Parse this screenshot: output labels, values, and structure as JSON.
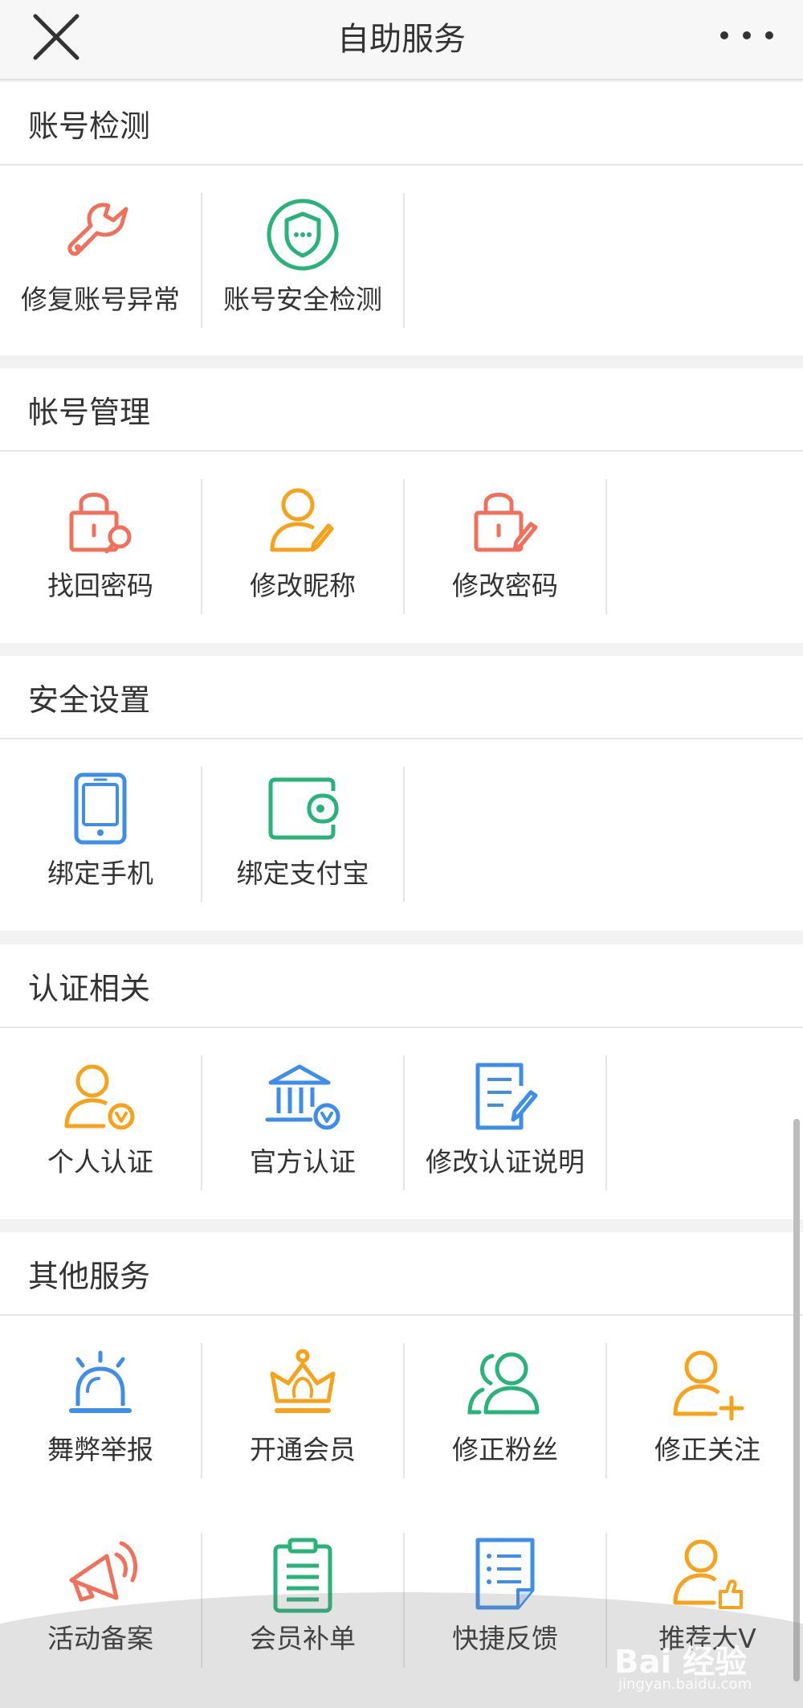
{
  "header": {
    "title": "自助服务"
  },
  "sections": [
    {
      "title": "账号检测",
      "items": [
        {
          "label": "修复账号异常",
          "icon": "wrench-icon",
          "color": "#f0705c"
        },
        {
          "label": "账号安全检测",
          "icon": "shield-icon",
          "color": "#27b37a"
        }
      ]
    },
    {
      "title": "帐号管理",
      "items": [
        {
          "label": "找回密码",
          "icon": "lock-search-icon",
          "color": "#f0705c"
        },
        {
          "label": "修改昵称",
          "icon": "user-edit-icon",
          "color": "#f7a21b"
        },
        {
          "label": "修改密码",
          "icon": "lock-edit-icon",
          "color": "#f0705c"
        }
      ]
    },
    {
      "title": "安全设置",
      "items": [
        {
          "label": "绑定手机",
          "icon": "phone-icon",
          "color": "#3e8ee9"
        },
        {
          "label": "绑定支付宝",
          "icon": "wallet-icon",
          "color": "#27b37a"
        }
      ]
    },
    {
      "title": "认证相关",
      "items": [
        {
          "label": "个人认证",
          "icon": "user-verified-icon",
          "color": "#f7a21b"
        },
        {
          "label": "官方认证",
          "icon": "bank-verified-icon",
          "color": "#3e8ee9"
        },
        {
          "label": "修改认证说明",
          "icon": "document-edit-icon",
          "color": "#3e8ee9"
        }
      ]
    },
    {
      "title": "其他服务",
      "items": [
        {
          "label": "舞弊举报",
          "icon": "alarm-icon",
          "color": "#3e8ee9"
        },
        {
          "label": "开通会员",
          "icon": "crown-icon",
          "color": "#f7a21b"
        },
        {
          "label": "修正粉丝",
          "icon": "users-icon",
          "color": "#27b37a"
        },
        {
          "label": "修正关注",
          "icon": "user-add-icon",
          "color": "#f7a21b"
        },
        {
          "label": "活动备案",
          "icon": "megaphone-icon",
          "color": "#f0705c"
        },
        {
          "label": "会员补单",
          "icon": "clipboard-icon",
          "color": "#27b37a"
        },
        {
          "label": "快捷反馈",
          "icon": "feedback-icon",
          "color": "#3e8ee9"
        },
        {
          "label": "推荐大V",
          "icon": "user-thumbs-up-icon",
          "color": "#f7a21b"
        }
      ]
    }
  ],
  "watermark": {
    "text": "Bai 经验",
    "sub": "jingyan.baidu.com"
  }
}
